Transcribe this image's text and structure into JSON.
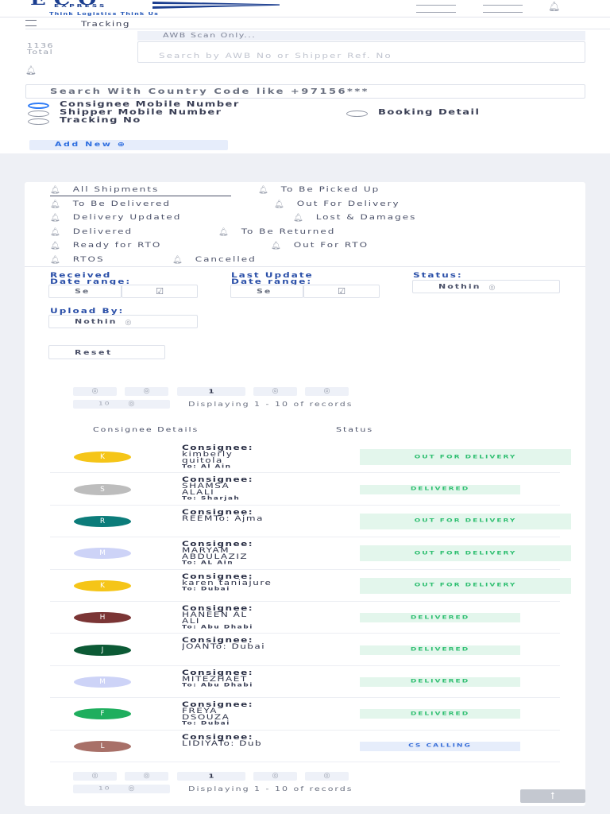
{
  "brand": {
    "name": "ECO",
    "sub": "EXPRESS",
    "tagline": "Think Logistics Think Us"
  },
  "header": {
    "page_title": "Tracking",
    "total_count": "1136",
    "total_label": "Total"
  },
  "awb": {
    "label": "AWB Scan Only...",
    "placeholder": "Search by AWB No or Shipper Ref. No"
  },
  "mobile_search": {
    "placeholder": "Search With Country Code like +97156***"
  },
  "search_options": [
    {
      "label": "Consignee Mobile Number",
      "selected": true
    },
    {
      "label": "Shipper Mobile Number",
      "selected": false
    },
    {
      "label": "Booking Detail",
      "selected": false
    },
    {
      "label": "Tracking No",
      "selected": false
    }
  ],
  "add_new_label": "Add New ⊕",
  "tabs": [
    {
      "label": "All Shipments",
      "active": true
    },
    {
      "label": "To Be Picked Up"
    },
    {
      "label": "To Be Delivered"
    },
    {
      "label": "Out For Delivery"
    },
    {
      "label": "Delivery Updated"
    },
    {
      "label": "Lost & Damages"
    },
    {
      "label": "Delivered"
    },
    {
      "label": "To Be Returned"
    },
    {
      "label": "Ready for RTO"
    },
    {
      "label": "Out For RTO"
    },
    {
      "label": "RTOS"
    },
    {
      "label": "Cancelled"
    }
  ],
  "filters": {
    "received": {
      "label_line1": "Received",
      "label_line2": "Date range:",
      "placeholder": "Se"
    },
    "last_update": {
      "label_line1": "Last Update",
      "label_line2": "Date range:",
      "placeholder": "Se"
    },
    "status": {
      "label": "Status:",
      "value": "Nothin"
    },
    "upload_by": {
      "label": "Upload By:",
      "value": "Nothin"
    },
    "reset_label": "Reset"
  },
  "pagination": {
    "current_page": "1",
    "page_size": "10",
    "summary": "Displaying 1 - 10 of records",
    "nav_glyph": "◎"
  },
  "table": {
    "headers": [
      "Consignee Details",
      "Status"
    ],
    "consignee_label": "Consignee:",
    "rows": [
      {
        "initial": "K",
        "color": "#f5c518",
        "name1": "kimberly",
        "name2": "quitola",
        "to": "To: Al Ain",
        "status": "OUT FOR DELIVERY",
        "status_kind": "green-wide"
      },
      {
        "initial": "S",
        "color": "#bdbdbd",
        "name1": "SHAMSA",
        "name2": "ALALI",
        "to": "To: Sharjah",
        "status": "DELIVERED",
        "status_kind": "green"
      },
      {
        "initial": "R",
        "color": "#0c7c7a",
        "name1": "REEMTo: Ajma",
        "name2": "",
        "to": "",
        "status": "OUT FOR DELIVERY",
        "status_kind": "green-wide"
      },
      {
        "initial": "M",
        "color": "#cdd3f7",
        "name1": "MARYAM",
        "name2": "ABDULAZIZ",
        "to": "To: AL Ain",
        "status": "OUT FOR DELIVERY",
        "status_kind": "green-wide"
      },
      {
        "initial": "K",
        "color": "#f5c518",
        "name1": "karen taniajure",
        "name2": "",
        "to": "To: Dubai",
        "status": "OUT FOR DELIVERY",
        "status_kind": "green-wide"
      },
      {
        "initial": "H",
        "color": "#7b3535",
        "name1": "HANEEN AL",
        "name2": "ALI",
        "to": "To: Abu Dhabi",
        "status": "DELIVERED",
        "status_kind": "green"
      },
      {
        "initial": "J",
        "color": "#0c5a35",
        "name1": "JOANTo: Dubai",
        "name2": "",
        "to": "",
        "status": "DELIVERED",
        "status_kind": "green"
      },
      {
        "initial": "M",
        "color": "#cdd3f7",
        "name1": "MITEZHAET",
        "name2": "",
        "to": "To: Abu Dhabi",
        "status": "DELIVERED",
        "status_kind": "green"
      },
      {
        "initial": "F",
        "color": "#1fae5e",
        "name1": "FREYA",
        "name2": "DSOUZA",
        "to": "To: Dubai",
        "status": "DELIVERED",
        "status_kind": "green"
      },
      {
        "initial": "L",
        "color": "#a87068",
        "name1": "LIDIYATo: Dub",
        "name2": "",
        "to": "",
        "status": "CS CALLING",
        "status_kind": "blue"
      }
    ]
  },
  "scroll_top_glyph": "⭡"
}
